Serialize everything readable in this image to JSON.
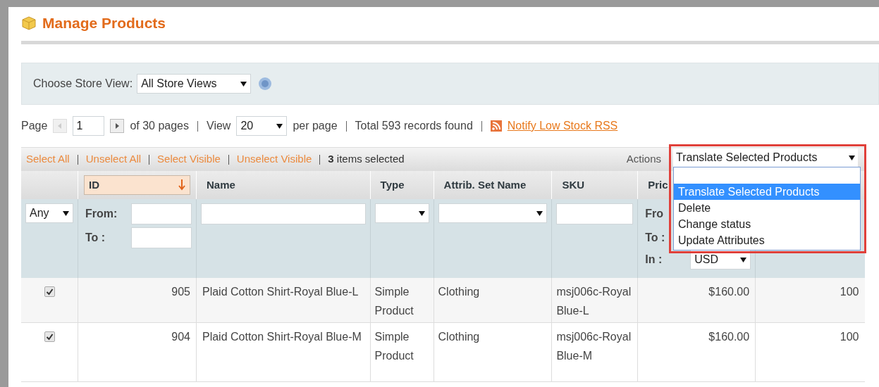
{
  "title": "Manage Products",
  "store_view": {
    "label": "Choose Store View:",
    "value": "All Store Views"
  },
  "pager": {
    "page_label": "Page",
    "page": "1",
    "of_pages": "of 30 pages",
    "view_label": "View",
    "per_page": "20",
    "per_page_label": "per page",
    "total": "Total 593 records found",
    "rss_link": "Notify Low Stock RSS"
  },
  "massaction": {
    "links": [
      "Select All",
      "Unselect All",
      "Select Visible",
      "Unselect Visible"
    ],
    "count": "3",
    "count_label": "items selected",
    "actions_label": "Actions",
    "actions_value": "Translate Selected Products",
    "options": [
      {
        "label": "Translate Selected Products",
        "selected": true
      },
      {
        "label": "Delete",
        "selected": false
      },
      {
        "label": "Change status",
        "selected": false
      },
      {
        "label": "Update Attributes",
        "selected": false
      }
    ]
  },
  "table": {
    "columns": [
      {
        "label": "ID",
        "sorted": true
      },
      {
        "label": "Name",
        "sorted": false
      },
      {
        "label": "Type",
        "sorted": false
      },
      {
        "label": "Attrib. Set Name",
        "sorted": false
      },
      {
        "label": "SKU",
        "sorted": false
      },
      {
        "label": "Pric",
        "sorted": false
      }
    ],
    "filters": {
      "select_any": "Any",
      "from": "From:",
      "to": "To :",
      "price_from": "Fro",
      "price_to": "To :",
      "price_in": "In :",
      "currency": "USD"
    },
    "rows": [
      {
        "checked": true,
        "id": "905",
        "name": "Plaid Cotton Shirt-Royal Blue-L",
        "type": "Simple Product",
        "attrib_set": "Clothing",
        "sku": "msj006c-Royal Blue-L",
        "price": "$160.00",
        "column_8": "100"
      },
      {
        "checked": true,
        "id": "904",
        "name": "Plaid Cotton Shirt-Royal Blue-M",
        "type": "Simple Product",
        "attrib_set": "Clothing",
        "sku": "msj006c-Royal Blue-M",
        "price": "$160.00",
        "column_8": "100"
      }
    ]
  }
}
